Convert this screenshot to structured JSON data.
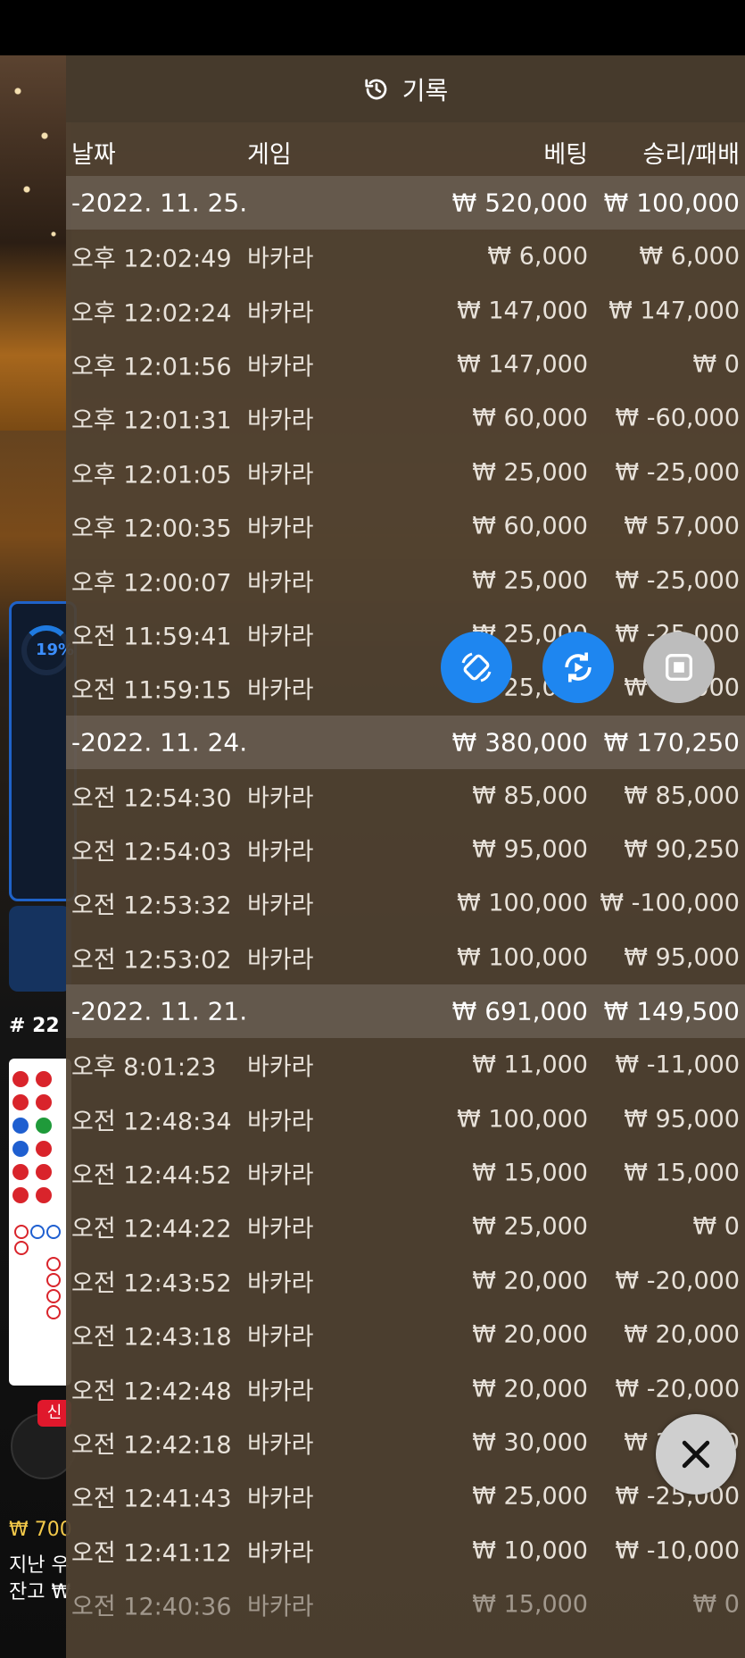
{
  "header": {
    "title": "기록",
    "icon": "history-icon"
  },
  "columns": {
    "date": "날짜",
    "game": "게임",
    "bet": "베팅",
    "result": "승리/패배"
  },
  "groups": [
    {
      "date": "-2022. 11. 25.",
      "bet_total": "₩ 520,000",
      "result_total": "₩ 100,000",
      "rows": [
        {
          "time": "오후 12:02:49",
          "game": "바카라",
          "bet": "₩ 6,000",
          "result": "₩ 6,000"
        },
        {
          "time": "오후 12:02:24",
          "game": "바카라",
          "bet": "₩ 147,000",
          "result": "₩ 147,000"
        },
        {
          "time": "오후 12:01:56",
          "game": "바카라",
          "bet": "₩ 147,000",
          "result": "₩ 0"
        },
        {
          "time": "오후 12:01:31",
          "game": "바카라",
          "bet": "₩ 60,000",
          "result": "₩ -60,000"
        },
        {
          "time": "오후 12:01:05",
          "game": "바카라",
          "bet": "₩ 25,000",
          "result": "₩ -25,000"
        },
        {
          "time": "오후 12:00:35",
          "game": "바카라",
          "bet": "₩ 60,000",
          "result": "₩ 57,000"
        },
        {
          "time": "오후 12:00:07",
          "game": "바카라",
          "bet": "₩ 25,000",
          "result": "₩ -25,000"
        },
        {
          "time": "오전 11:59:41",
          "game": "바카라",
          "bet": "₩ 25,000",
          "result": "₩ -25,000"
        },
        {
          "time": "오전 11:59:15",
          "game": "바카라",
          "bet": "₩ 25,000",
          "result": "₩ 25,000"
        }
      ]
    },
    {
      "date": "-2022. 11. 24.",
      "bet_total": "₩ 380,000",
      "result_total": "₩ 170,250",
      "rows": [
        {
          "time": "오전 12:54:30",
          "game": "바카라",
          "bet": "₩ 85,000",
          "result": "₩ 85,000"
        },
        {
          "time": "오전 12:54:03",
          "game": "바카라",
          "bet": "₩ 95,000",
          "result": "₩ 90,250"
        },
        {
          "time": "오전 12:53:32",
          "game": "바카라",
          "bet": "₩ 100,000",
          "result": "₩ -100,000"
        },
        {
          "time": "오전 12:53:02",
          "game": "바카라",
          "bet": "₩ 100,000",
          "result": "₩ 95,000"
        }
      ]
    },
    {
      "date": "-2022. 11. 21.",
      "bet_total": "₩ 691,000",
      "result_total": "₩ 149,500",
      "rows": [
        {
          "time": "오후 8:01:23",
          "game": "바카라",
          "bet": "₩ 11,000",
          "result": "₩ -11,000"
        },
        {
          "time": "오전 12:48:34",
          "game": "바카라",
          "bet": "₩ 100,000",
          "result": "₩ 95,000"
        },
        {
          "time": "오전 12:44:52",
          "game": "바카라",
          "bet": "₩ 15,000",
          "result": "₩ 15,000"
        },
        {
          "time": "오전 12:44:22",
          "game": "바카라",
          "bet": "₩ 25,000",
          "result": "₩ 0"
        },
        {
          "time": "오전 12:43:52",
          "game": "바카라",
          "bet": "₩ 20,000",
          "result": "₩ -20,000"
        },
        {
          "time": "오전 12:43:18",
          "game": "바카라",
          "bet": "₩ 20,000",
          "result": "₩ 20,000"
        },
        {
          "time": "오전 12:42:48",
          "game": "바카라",
          "bet": "₩ 20,000",
          "result": "₩ -20,000"
        },
        {
          "time": "오전 12:42:18",
          "game": "바카라",
          "bet": "₩ 30,000",
          "result": "₩ 30,000"
        },
        {
          "time": "오전 12:41:43",
          "game": "바카라",
          "bet": "₩ 25,000",
          "result": "₩ -25,000"
        },
        {
          "time": "오전 12:41:12",
          "game": "바카라",
          "bet": "₩ 10,000",
          "result": "₩ -10,000"
        },
        {
          "time": "오전 12:40:36",
          "game": "바카라",
          "bet": "₩ 15,000",
          "result": "₩ 0"
        }
      ]
    }
  ],
  "background": {
    "progress_ring": "19%",
    "table_number": "# 22",
    "new_badge": "신",
    "balance_prefix": "₩ 700",
    "last_label": "지난 우",
    "balance_label": "잔고 ₩"
  },
  "controls": [
    "rotate-icon",
    "auto-play-icon",
    "stop-icon",
    "close-icon"
  ],
  "colors": {
    "accent_blue": "#1e86f0",
    "panel": "#504232",
    "group_row": "#786e64"
  }
}
